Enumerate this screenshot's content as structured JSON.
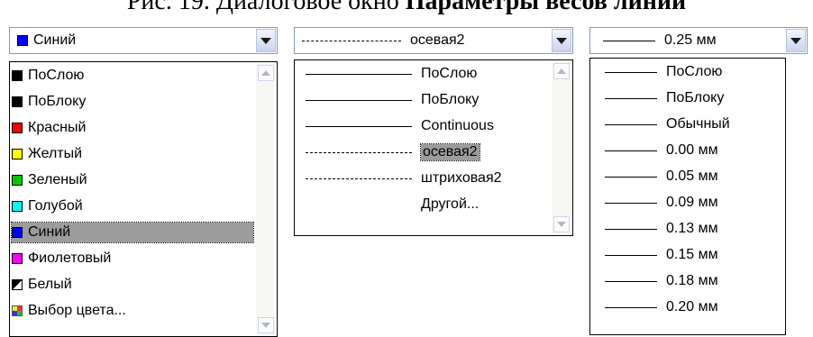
{
  "caption": {
    "prefix": "Рис. 19. Диалоговое окно ",
    "bold": "Параметры весов линий"
  },
  "color_combo": {
    "value": "Синий",
    "swatch": "#0000ff"
  },
  "linetype_combo": {
    "value": "осевая2"
  },
  "lineweight_combo": {
    "value": "0.25 мм"
  },
  "color_list": {
    "items": [
      {
        "label": "ПоСлою",
        "color": "#000000"
      },
      {
        "label": "ПоБлоку",
        "color": "#000000"
      },
      {
        "label": "Красный",
        "color": "#ff0000"
      },
      {
        "label": "Желтый",
        "color": "#ffff00"
      },
      {
        "label": "Зеленый",
        "color": "#00c800"
      },
      {
        "label": "Голубой",
        "color": "#00ffff"
      },
      {
        "label": "Синий",
        "color": "#0000ff",
        "selected": true
      },
      {
        "label": "Фиолетовый",
        "color": "#ff00ff"
      },
      {
        "label": "Белый",
        "color": "#ffffff"
      },
      {
        "label": "Выбор цвета...",
        "color": "multi"
      }
    ]
  },
  "linetype_list": {
    "items": [
      {
        "label": "ПоСлою",
        "style": "solid"
      },
      {
        "label": "ПоБлоку",
        "style": "solid"
      },
      {
        "label": "Continuous",
        "style": "solid"
      },
      {
        "label": "осевая2",
        "style": "dashdot",
        "selected": true
      },
      {
        "label": "штриховая2",
        "style": "dash"
      },
      {
        "label": "Другой...",
        "style": "none"
      }
    ]
  },
  "lineweight_list": {
    "items": [
      {
        "label": "ПоСлою"
      },
      {
        "label": "ПоБлоку"
      },
      {
        "label": "Обычный"
      },
      {
        "label": "0.00 мм"
      },
      {
        "label": "0.05 мм"
      },
      {
        "label": "0.09 мм"
      },
      {
        "label": "0.13 мм"
      },
      {
        "label": "0.15 мм"
      },
      {
        "label": "0.18 мм"
      },
      {
        "label": "0.20 мм"
      }
    ]
  }
}
